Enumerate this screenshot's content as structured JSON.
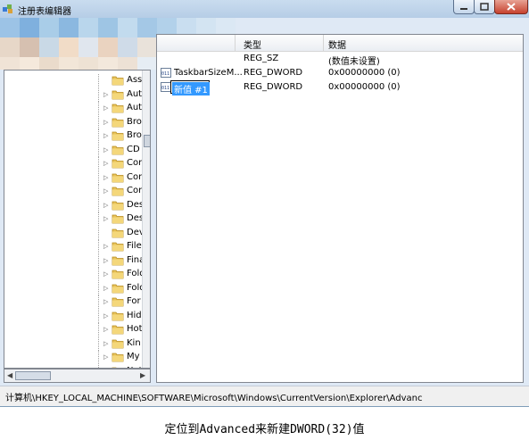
{
  "window": {
    "title": "注册表编辑器",
    "controls": {
      "minimize": "minimize-icon",
      "maximize": "maximize-icon",
      "close": "close-icon"
    }
  },
  "tree": {
    "items": [
      {
        "label": "Ass",
        "expandable": false
      },
      {
        "label": "Aut",
        "expandable": true
      },
      {
        "label": "Aut",
        "expandable": true
      },
      {
        "label": "Bro",
        "expandable": true
      },
      {
        "label": "Bro",
        "expandable": true
      },
      {
        "label": "CD",
        "expandable": true
      },
      {
        "label": "Cor",
        "expandable": true
      },
      {
        "label": "Cor",
        "expandable": true
      },
      {
        "label": "Cor",
        "expandable": true
      },
      {
        "label": "Des",
        "expandable": true
      },
      {
        "label": "Des",
        "expandable": true
      },
      {
        "label": "Dev",
        "expandable": false
      },
      {
        "label": "File",
        "expandable": true
      },
      {
        "label": "Fina",
        "expandable": true
      },
      {
        "label": "Fold",
        "expandable": true
      },
      {
        "label": "Fold",
        "expandable": true
      },
      {
        "label": "For",
        "expandable": true
      },
      {
        "label": "Hid",
        "expandable": true
      },
      {
        "label": "Hot",
        "expandable": true
      },
      {
        "label": "Kin",
        "expandable": true
      },
      {
        "label": "My",
        "expandable": true
      },
      {
        "label": "Net",
        "expandable": true
      }
    ]
  },
  "list": {
    "columns": {
      "type": "类型",
      "data": "数据"
    },
    "rows": [
      {
        "name": "",
        "type": "REG_SZ",
        "data": "(数值未设置)"
      },
      {
        "name": "TaskbarSizeM...",
        "type": "REG_DWORD",
        "data": "0x00000000 (0)"
      },
      {
        "name": "新值 #1",
        "type": "REG_DWORD",
        "data": "0x00000000 (0)",
        "editing": true
      }
    ]
  },
  "status": {
    "path": "计算机\\HKEY_LOCAL_MACHINE\\SOFTWARE\\Microsoft\\Windows\\CurrentVersion\\Explorer\\Advanc"
  },
  "caption": "定位到Advanced来新建DWORD(32)值"
}
